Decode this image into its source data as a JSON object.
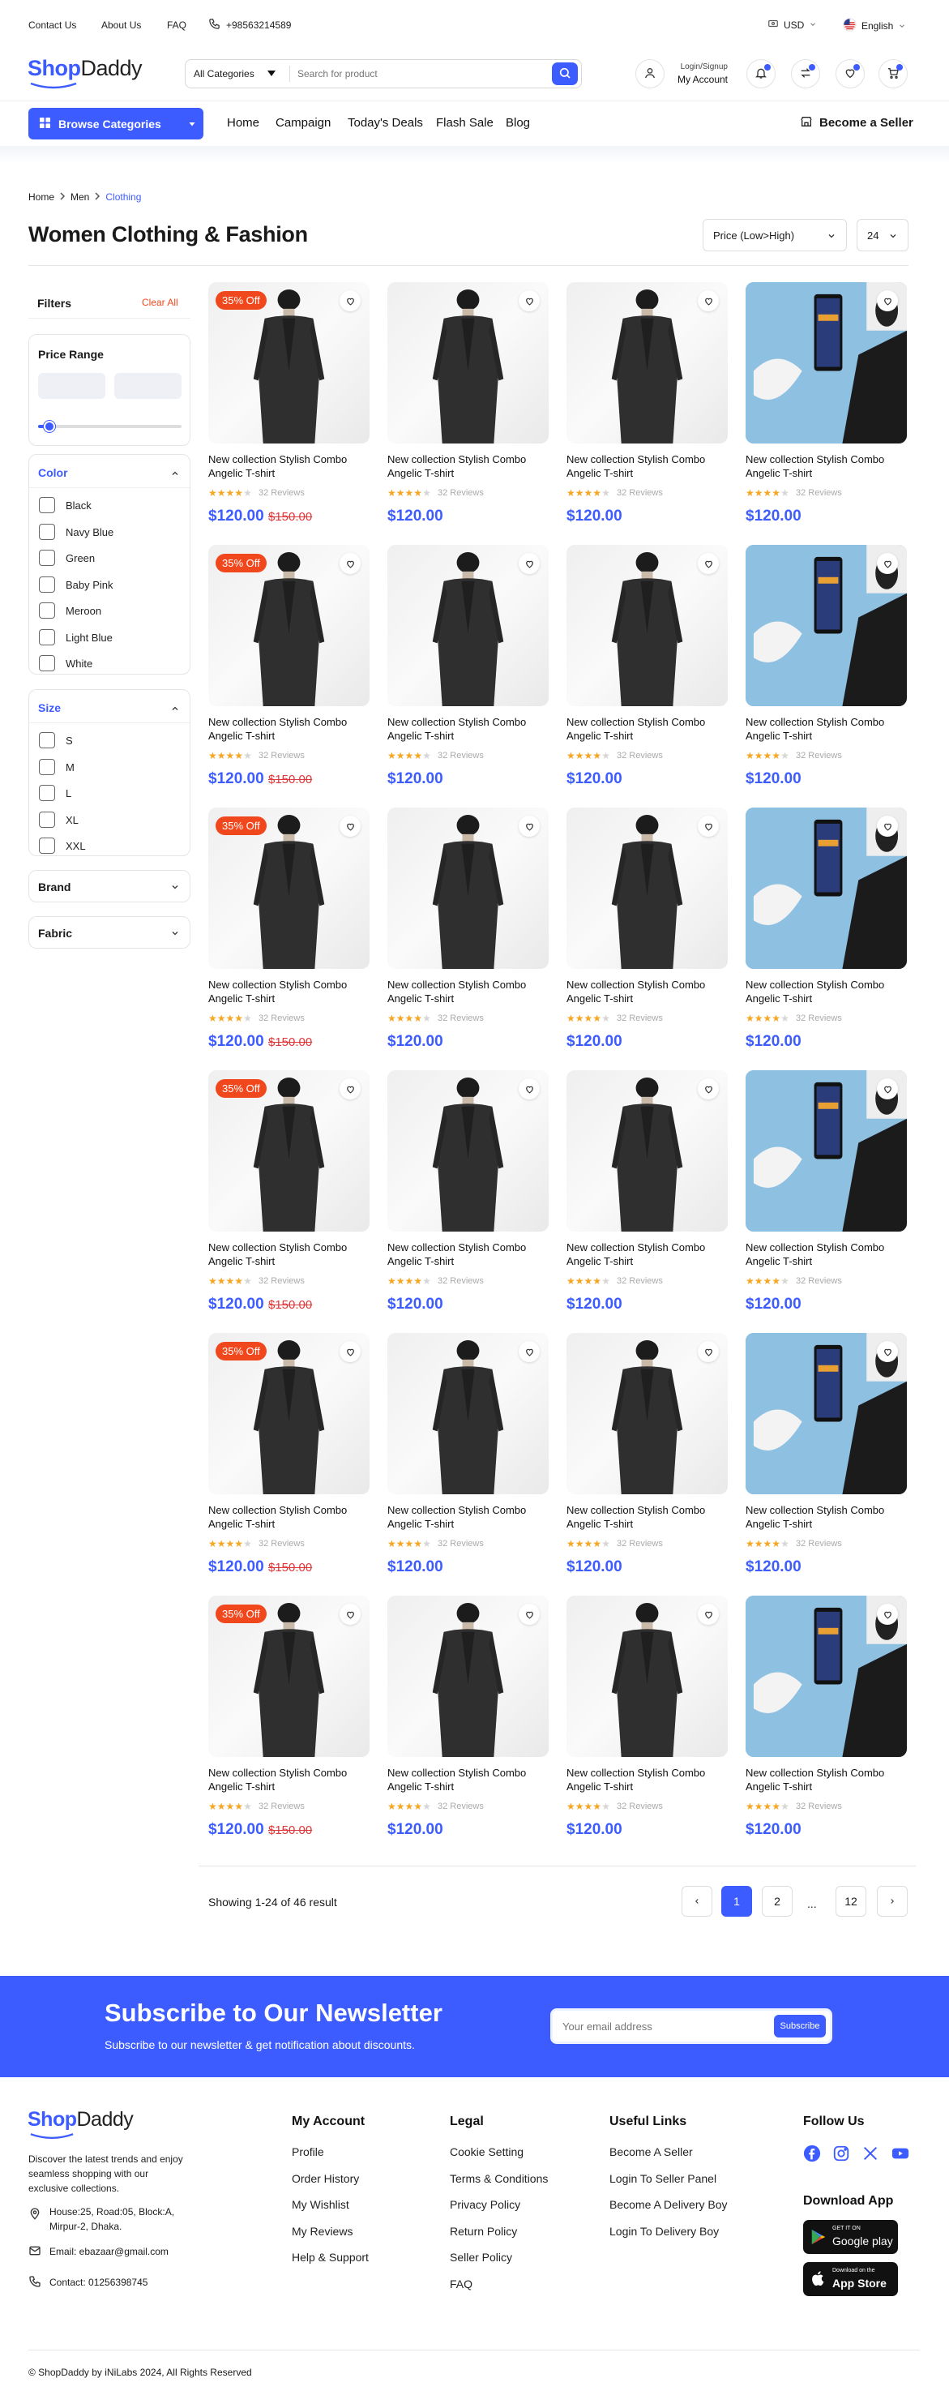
{
  "topbar": {
    "contact": "Contact Us",
    "about": "About Us",
    "faq": "FAQ",
    "phone": "+98563214589",
    "currency": "USD",
    "language": "English"
  },
  "header": {
    "logo_a": "Shop",
    "logo_b": "Daddy",
    "category_select": "All Categories",
    "search_placeholder": "Search for product",
    "login_line1": "Login/Signup",
    "login_line2": "My Account"
  },
  "nav": {
    "browse": "Browse Categories",
    "links": [
      "Home",
      "Campaign",
      "Today's Deals",
      "Flash Sale",
      "Blog"
    ],
    "seller": "Become a Seller"
  },
  "breadcrumb": {
    "home": "Home",
    "men": "Men",
    "current": "Clothing"
  },
  "page": {
    "title": "Women Clothing & Fashion",
    "sort": "Price (Low>High)",
    "per_page": "24"
  },
  "filters": {
    "title": "Filters",
    "clear": "Clear All",
    "price_range": "Price Range",
    "price_slider_fraction": 0.08,
    "color_title": "Color",
    "colors": [
      "Black",
      "Navy Blue",
      "Green",
      "Baby Pink",
      "Meroon",
      "Light Blue",
      "White"
    ],
    "size_title": "Size",
    "sizes": [
      "S",
      "M",
      "L",
      "XL",
      "XXL"
    ],
    "brand": "Brand",
    "fabric": "Fabric"
  },
  "product": {
    "badge": "35% Off",
    "name_line1": "New collection Stylish Combo",
    "name_line2": "Angelic T-shirt",
    "reviews": "32 Reviews",
    "rating": 4,
    "price": "$120.00",
    "old_price": "$150.00"
  },
  "pagination": {
    "summary": "Showing 1-24 of 46 result",
    "pages": [
      "1",
      "2",
      "...",
      "12"
    ]
  },
  "newsletter": {
    "title": "Subscribe to Our Newsletter",
    "subtitle": "Subscribe to our newsletter & get notification about discounts.",
    "placeholder": "Your email address",
    "button": "Subscribe"
  },
  "footer": {
    "about": [
      "Discover the latest trends and enjoy",
      "seamless shopping with our",
      "exclusive collections."
    ],
    "address_1": "House:25, Road:05, Block:A,",
    "address_2": "Mirpur-2, Dhaka.",
    "email": "Email: ebazaar@gmail.com",
    "contact": "Contact: 01256398745",
    "account_title": "My Account",
    "account": [
      "Profile",
      "Order History",
      "My Wishlist",
      "My Reviews",
      "Help & Support"
    ],
    "legal_title": "Legal",
    "legal": [
      "Cookie Setting",
      "Terms & Conditions",
      "Privacy Policy",
      "Return Policy",
      "Seller Policy",
      "FAQ"
    ],
    "useful_title": "Useful Links",
    "useful": [
      "Become A Seller",
      "Login To Seller Panel",
      "Become A Delivery Boy",
      "Login To Delivery Boy"
    ],
    "follow_title": "Follow Us",
    "download_title": "Download App",
    "gp_small": "GET IT ON",
    "gp_big": "Google play",
    "as_small": "Download on the",
    "as_big": "App Store",
    "copyright": "© ShopDaddy by iNiLabs 2024, All Rights Reserved"
  },
  "colors": {
    "accent": "#3d5cff",
    "sale": "#f1471d",
    "old_price": "#e0383a",
    "star": "#f5a623"
  }
}
